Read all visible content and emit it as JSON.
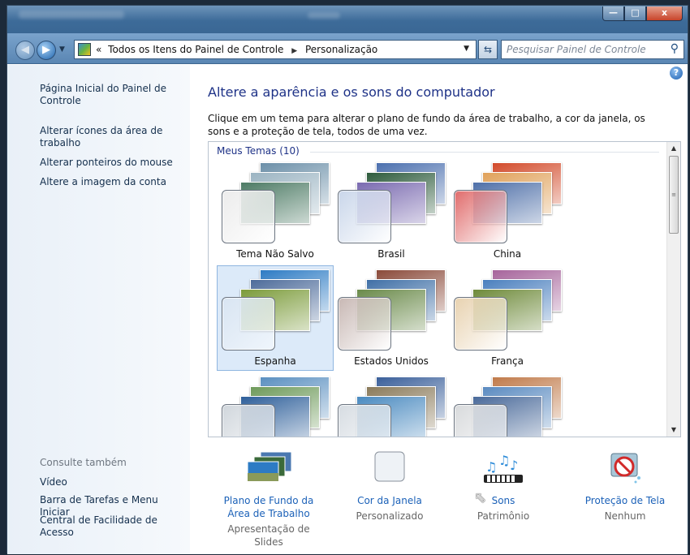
{
  "window": {
    "minimize_glyph": "—",
    "maximize_glyph": "□",
    "close_glyph": "x"
  },
  "navbar": {
    "breadcrumb": [
      "Todos os Itens do Painel de Controle",
      "Personalização"
    ],
    "overflow_chevron": "«",
    "search_placeholder": "Pesquisar Painel de Controle"
  },
  "sidebar": {
    "home_link": "Página Inicial do Painel de Controle",
    "links": [
      "Alterar ícones da área de trabalho",
      "Alterar ponteiros do mouse",
      "Altere a imagem da conta"
    ],
    "see_also_title": "Consulte também",
    "see_also": [
      "Vídeo",
      "Barra de Tarefas e Menu Iniciar",
      "Central de Facilidade de Acesso"
    ]
  },
  "main": {
    "title": "Altere a aparência e os sons do computador",
    "description": "Clique em um tema para alterar o plano de fundo da área de trabalho, a cor da janela, os sons e a proteção de tela, todos de uma vez.",
    "help_glyph": "?"
  },
  "themes": {
    "group_label": "Meus Temas (10)",
    "selected": "Espanha",
    "items": [
      {
        "name": "Tema Não Salvo",
        "swatch": "#ececec",
        "slides": [
          "#6b8fa8",
          "#9bb4c2",
          "#4c7a64"
        ]
      },
      {
        "name": "Brasil",
        "swatch": "#c9d6ea",
        "slides": [
          "#4b6fae",
          "#2d5b3c",
          "#7a6ab0"
        ]
      },
      {
        "name": "China",
        "swatch": "#e06b6b",
        "slides": [
          "#d24a2a",
          "#e0a15a",
          "#4e6fa8"
        ]
      },
      {
        "name": "Espanha",
        "swatch": "#d9e5f2",
        "slides": [
          "#2d7bc4",
          "#4d6b9a",
          "#7b9b3a"
        ]
      },
      {
        "name": "Estados Unidos",
        "swatch": "#c8b8b4",
        "slides": [
          "#8a4a3a",
          "#3f6fa6",
          "#6a8a4a"
        ]
      },
      {
        "name": "França",
        "swatch": "#e8d2b0",
        "slides": [
          "#a6649b",
          "#4a7fbe",
          "#6e8a3a"
        ]
      },
      {
        "name": "",
        "swatch": "#d0d6dc",
        "slides": [
          "#5a8fc0",
          "#6e9a5a",
          "#2e5f9a"
        ]
      },
      {
        "name": "",
        "swatch": "#d6dce2",
        "slides": [
          "#3a5f9a",
          "#8a7a5a",
          "#4a8ac0"
        ]
      },
      {
        "name": "",
        "swatch": "#d8dadc",
        "slides": [
          "#c07a4a",
          "#5a8ac0",
          "#4a6a9a"
        ]
      }
    ]
  },
  "bottom": {
    "items": [
      {
        "label": "Plano de Fundo da Área de Trabalho",
        "value": "Apresentação de Slides",
        "icon": "desktop-background-icon"
      },
      {
        "label": "Cor da Janela",
        "value": "Personalizado",
        "icon": "window-color-icon"
      },
      {
        "label": "Sons",
        "value": "Patrimônio",
        "icon": "sounds-icon"
      },
      {
        "label": "Proteção de Tela",
        "value": "Nenhum",
        "icon": "screensaver-icon"
      }
    ]
  }
}
